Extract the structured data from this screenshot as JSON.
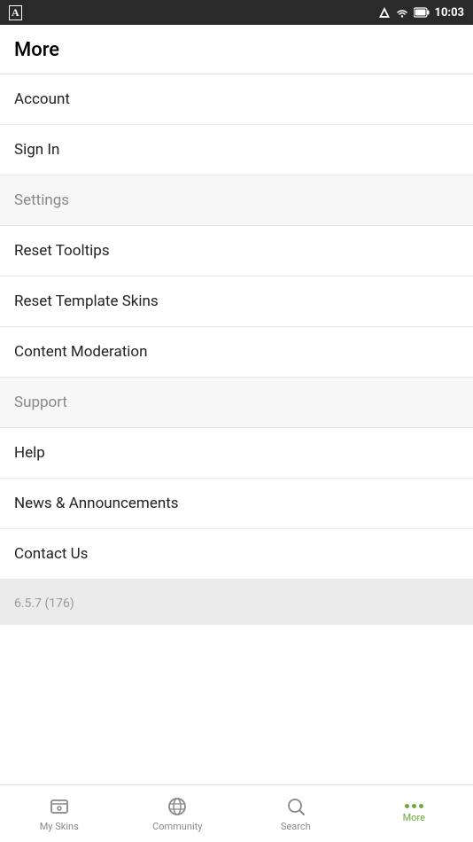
{
  "statusBar": {
    "time": "10:03"
  },
  "header": {
    "title": "More"
  },
  "menuItems": [
    {
      "id": "account",
      "label": "Account",
      "section": false
    },
    {
      "id": "sign-in",
      "label": "Sign In",
      "section": false
    },
    {
      "id": "settings",
      "label": "Settings",
      "section": true
    },
    {
      "id": "reset-tooltips",
      "label": "Reset Tooltips",
      "section": false
    },
    {
      "id": "reset-template-skins",
      "label": "Reset Template Skins",
      "section": false
    },
    {
      "id": "content-moderation",
      "label": "Content Moderation",
      "section": false
    },
    {
      "id": "support",
      "label": "Support",
      "section": true
    },
    {
      "id": "help",
      "label": "Help",
      "section": false
    },
    {
      "id": "news-announcements",
      "label": "News & Announcements",
      "section": false
    },
    {
      "id": "contact-us",
      "label": "Contact Us",
      "section": false
    }
  ],
  "version": "6.5.7 (176)",
  "bottomNav": {
    "items": [
      {
        "id": "my-skins",
        "label": "My Skins",
        "active": false
      },
      {
        "id": "community",
        "label": "Community",
        "active": false
      },
      {
        "id": "search",
        "label": "Search",
        "active": false
      },
      {
        "id": "more",
        "label": "More",
        "active": true
      }
    ]
  }
}
